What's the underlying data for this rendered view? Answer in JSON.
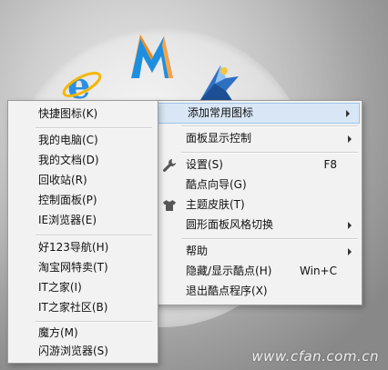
{
  "main_menu": {
    "items": [
      {
        "label": "添加常用图标",
        "has_submenu": true,
        "highlighted": true
      },
      {
        "label": "面板显示控制",
        "has_submenu": true
      },
      {
        "label": "设置(S)",
        "shortcut": "F8",
        "icon": "wrench-icon"
      },
      {
        "label": "酷点向导(G)"
      },
      {
        "label": "主题皮肤(T)",
        "icon": "tshirt-icon"
      },
      {
        "label": "圆形面板风格切换",
        "has_submenu": true
      },
      {
        "label": "帮助",
        "has_submenu": true
      },
      {
        "label": "隐藏/显示酷点(H)",
        "shortcut": "Win+C"
      },
      {
        "label": "退出酷点程序(X)"
      }
    ]
  },
  "sub_menu": {
    "items": [
      {
        "label": "快捷图标(K)"
      },
      {
        "label": "我的电脑(C)"
      },
      {
        "label": "我的文档(D)"
      },
      {
        "label": "回收站(R)"
      },
      {
        "label": "控制面板(P)"
      },
      {
        "label": "IE浏览器(E)"
      },
      {
        "label": "好123导航(H)"
      },
      {
        "label": "淘宝网特卖(T)"
      },
      {
        "label": "IT之家(I)"
      },
      {
        "label": "IT之家社区(B)"
      },
      {
        "label": "魔方(M)"
      },
      {
        "label": "闪游浏览器(S)"
      }
    ]
  },
  "watermark": "www.cfan.com.cn",
  "colors": {
    "highlight": "#d8e6f5",
    "menu_bg": "#f2f2f2",
    "m_logo_orange": "#f08a1c",
    "m_logo_blue": "#1e8fe0",
    "ie_blue": "#2b8fe6",
    "ie_ring": "#f5b700"
  }
}
